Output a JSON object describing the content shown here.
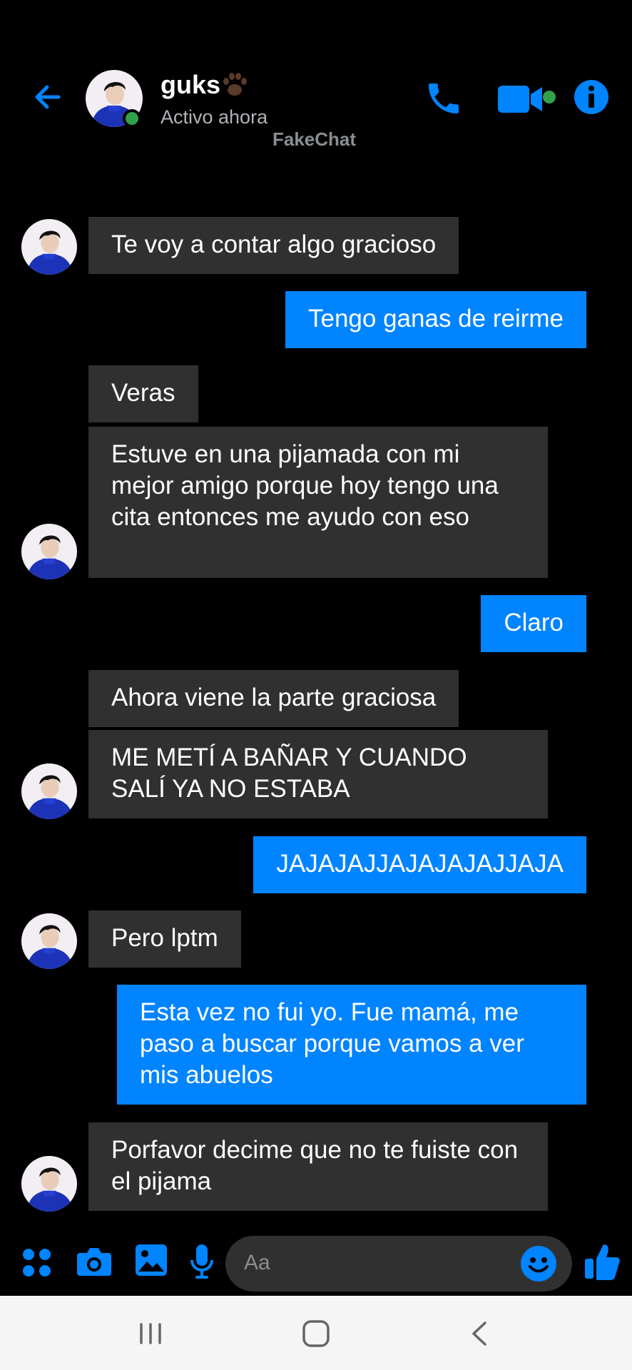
{
  "header": {
    "contact_name": "guks",
    "status": "Activo ahora",
    "watermark": "FakeChat"
  },
  "messages": [
    {
      "side": "in",
      "text": "Te voy a contar algo gracioso"
    },
    {
      "side": "out",
      "text": "Tengo ganas de reirme"
    },
    {
      "side": "in",
      "text": "Veras"
    },
    {
      "side": "in",
      "text": "Estuve en una pijamada con mi mejor amigo porque hoy tengo una cita entonces me ayudo con eso"
    },
    {
      "side": "out",
      "text": "Claro"
    },
    {
      "side": "in",
      "text": "Ahora viene la parte graciosa"
    },
    {
      "side": "in",
      "text": "ME METÍ A BAÑAR Y CUANDO SALÍ YA NO ESTABA"
    },
    {
      "side": "out",
      "text": "JAJAJAJJAJAJAJAJJAJA"
    },
    {
      "side": "in",
      "text": "Pero lptm"
    },
    {
      "side": "out",
      "text": "Esta vez no fui yo. Fue mamá, me paso a buscar porque vamos a ver mis abuelos"
    },
    {
      "side": "in",
      "text": "Porfavor decime que no te fuiste con el pijama"
    }
  ],
  "composer": {
    "placeholder": "Aa"
  },
  "colors": {
    "accent": "#0084ff",
    "incoming_bubble": "#303030",
    "background": "#000000",
    "online": "#31a24c"
  },
  "icons": [
    "back-arrow-icon",
    "paw-icon",
    "phone-icon",
    "video-camera-icon",
    "info-icon",
    "apps-grid-icon",
    "camera-icon",
    "image-icon",
    "microphone-icon",
    "emoji-icon",
    "thumbs-up-icon",
    "recents-icon",
    "home-icon",
    "back-icon"
  ]
}
